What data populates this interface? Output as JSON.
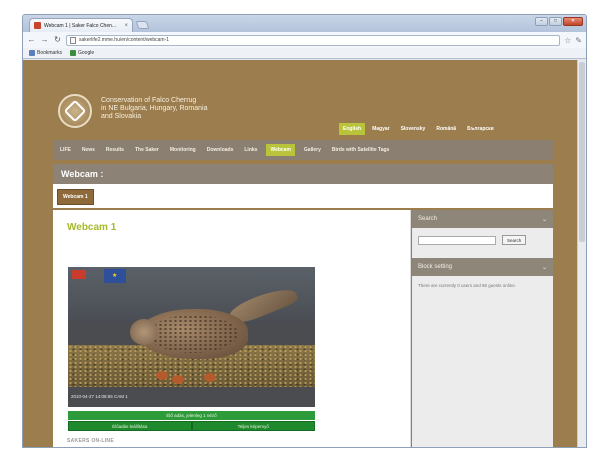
{
  "browser": {
    "tab_title": "Webcam 1 | Saker Falco Chen...",
    "tab_close": "×",
    "win_buttons": [
      "–",
      "□",
      "✕"
    ],
    "url": "sakerlife2.mme.hu/en/content/webcam-1",
    "bookmarks": [
      {
        "label": "Bookmarks",
        "color": "#5a7fbf"
      },
      {
        "label": "Google",
        "color": "#3b8d3b"
      }
    ]
  },
  "site": {
    "title_lines": [
      "Conservation of Falco Cherrug",
      "in NE Bulgaria, Hungary, Romania",
      "and Slovakia"
    ],
    "languages": [
      "English",
      "Magyar",
      "Slovensky",
      "Română",
      "Български"
    ],
    "active_language_index": 0,
    "nav": [
      "LIFE",
      "News",
      "Results",
      "The Saker",
      "Monitoring",
      "Downloads",
      "Links",
      "Webcam",
      "Gallery",
      "Birds with Satellite Tags"
    ],
    "active_nav_index": 7,
    "section_heading": "Webcam :",
    "subnav_items": [
      "Webcam 1"
    ],
    "page_title": "Webcam 1",
    "webcam": {
      "timestamp": "2010-04-27  14:08:55   CAM 1",
      "status": "Élő adás, jelenleg 1 néző",
      "buttons": [
        "Élőadás leállítása",
        "Teljes képernyő"
      ]
    },
    "section_caption": "SAKERS ON-LINE"
  },
  "sidebar": {
    "search": {
      "title": "Search",
      "button": "Search",
      "value": ""
    },
    "block": {
      "title": "Block setting",
      "text": "There are currently 0 users and 86 guests online."
    }
  },
  "colors": {
    "brand_brown": "#9c7d4e",
    "accent_green": "#b9c43a",
    "nav_gray": "#8a7f70"
  }
}
